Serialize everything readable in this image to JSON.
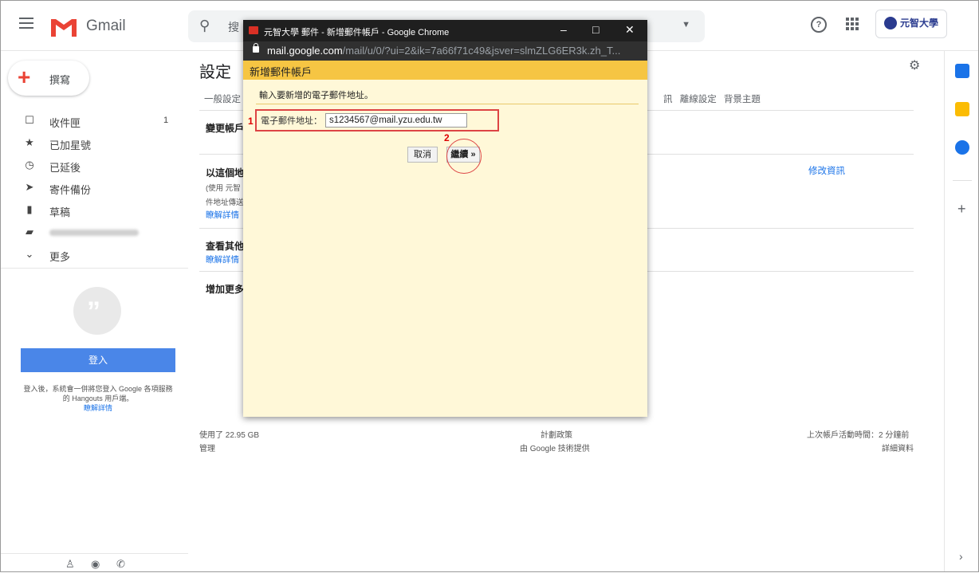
{
  "gmail": {
    "brand": "Gmail",
    "search_placeholder": "搜",
    "account_name": "元智大學",
    "compose_label": "撰寫",
    "nav": [
      {
        "icon": "inbox-icon",
        "label": "收件匣",
        "count": "1"
      },
      {
        "icon": "star-icon",
        "label": "已加星號"
      },
      {
        "icon": "clock-icon",
        "label": "已延後"
      },
      {
        "icon": "send-icon",
        "label": "寄件備份"
      },
      {
        "icon": "draft-icon",
        "label": "草稿"
      },
      {
        "icon": "label-icon",
        "label": ""
      },
      {
        "icon": "chevron-down-icon",
        "label": "更多"
      }
    ],
    "hangouts_signin": "登入",
    "hangouts_info": "登入後，系統會一併將您登入 Google 各項服務的 Hangouts 用戶端。",
    "hangouts_learn_more": "瞭解詳情"
  },
  "settings": {
    "title": "設定",
    "tab_first": "一般設定",
    "tabs_right": "訊 離線設定 背景主題",
    "change_account": "變更帳戶",
    "send_as": "以這個地",
    "send_as_note1": "(使用 元智",
    "send_as_note2": "件地址傳送",
    "learn_more_1": "瞭解詳情",
    "check_mail": "查看其他",
    "learn_more_2": "瞭解詳情",
    "add_more": "增加更多",
    "edit_info": "修改資訊",
    "storage_used": "使用了 22.95 GB",
    "manage": "管理",
    "program_policies": "計劃政策",
    "powered_by": "由 Google 技術提供",
    "last_activity": "上次帳戶活動時間：2 分鐘前",
    "details": "詳細資料"
  },
  "popup": {
    "window_title": "元智大學 郵件 - 新增郵件帳戶 - Google Chrome",
    "url_host": "mail.google.com",
    "url_rest": "/mail/u/0/?ui=2&ik=7a66f71c49&jsver=slmZLG6ER3k.zh_T...",
    "header": "新增郵件帳戶",
    "instruction": "輸入要新增的電子郵件地址。",
    "email_label": "電子郵件地址：",
    "email_value": "s1234567@mail.yzu.edu.tw",
    "cancel": "取消",
    "continue": "繼續 »",
    "step1": "1",
    "step2": "2"
  },
  "colors": {
    "gmail_red": "#ea4335",
    "popup_bg": "#fff8d8",
    "popup_header": "#f6c543",
    "annotation_red": "#dd2222",
    "signin_blue": "#4a86e8"
  }
}
